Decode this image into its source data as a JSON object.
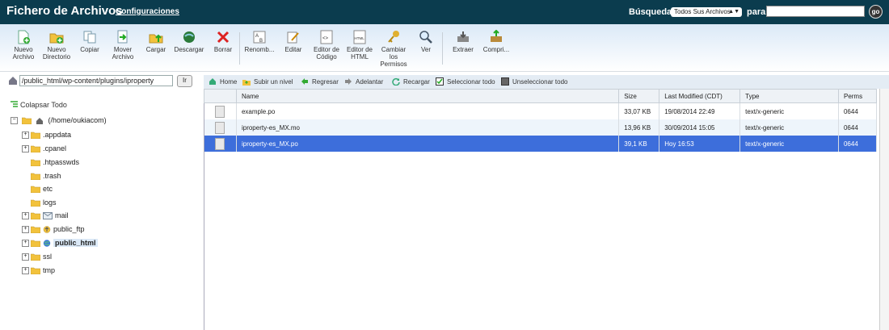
{
  "header": {
    "title": "Fichero de Archivos",
    "config_link": "Configuraciones",
    "search_label": "Búsqueda",
    "search_scope": "Todos Sus Archivos",
    "para_label": "para",
    "search_value": "",
    "go_label": "go"
  },
  "toolbar": {
    "nuevo_archivo": "Nuevo Archivo",
    "nuevo_directorio": "Nuevo Directorio",
    "copiar": "Copiar",
    "mover_archivo": "Mover Archivo",
    "cargar": "Cargar",
    "descargar": "Descargar",
    "borrar": "Borrar",
    "renombrar": "Renomb...",
    "editar": "Editar",
    "editor_codigo": "Editor de Código",
    "editor_html": "Editor de HTML",
    "cambiar_permisos": "Cambiar los Permisos",
    "ver": "Ver",
    "extraer": "Extraer",
    "comprimir": "Compri..."
  },
  "path": {
    "value": "/public_html/wp-content/plugins/iproperty",
    "go_label": "Ir"
  },
  "nav": {
    "home": "Home",
    "up": "Subir un nivel",
    "back": "Regresar",
    "forward": "Adelantar",
    "reload": "Recargar",
    "select_all": "Seleccionar todo",
    "unselect_all": "Unseleccionar todo"
  },
  "tree": {
    "collapse_all": "Colapsar Todo",
    "root": "(/home/oukiacom)",
    "items": [
      ".appdata",
      ".cpanel",
      ".htpasswds",
      ".trash",
      "etc",
      "logs",
      "mail",
      "public_ftp",
      "public_html",
      "ssl",
      "tmp"
    ]
  },
  "table": {
    "headers": [
      "Name",
      "Size",
      "Last Modified (CDT)",
      "Type",
      "Perms"
    ],
    "rows": [
      {
        "name": "example.po",
        "size": "33,07 KB",
        "modified": "19/08/2014 22:49",
        "type": "text/x-generic",
        "perms": "0644"
      },
      {
        "name": "iproperty-es_MX.mo",
        "size": "13,96 KB",
        "modified": "30/09/2014 15:05",
        "type": "text/x-generic",
        "perms": "0644"
      },
      {
        "name": "iproperty-es_MX.po",
        "size": "39,1 KB",
        "modified": "Hoy 16:53",
        "type": "text/x-generic",
        "perms": "0644"
      }
    ]
  },
  "colors": {
    "header_bg": "#0b3c4e",
    "selection": "#3d6edb",
    "folder": "#f2c23c"
  }
}
